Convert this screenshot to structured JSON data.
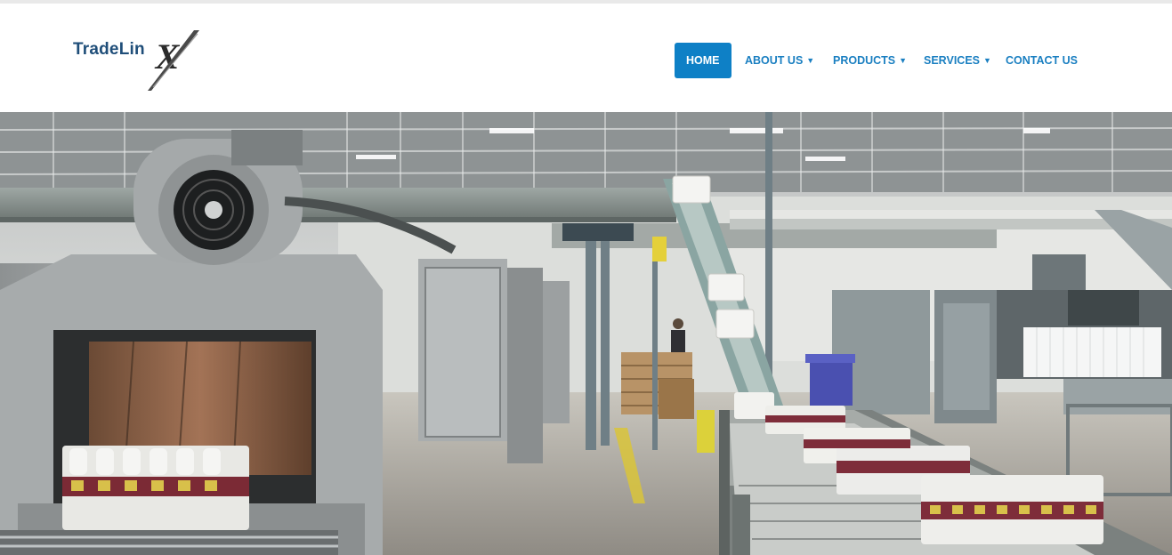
{
  "brand": {
    "name": "TradeLin",
    "mark": "X"
  },
  "nav": {
    "items": [
      {
        "label": "HOME",
        "caret": false,
        "active": true
      },
      {
        "label": "ABOUT US",
        "caret": true,
        "active": false
      },
      {
        "label": "PRODUCTS",
        "caret": true,
        "active": false
      },
      {
        "label": "SERVICES",
        "caret": true,
        "active": false
      },
      {
        "label": "CONTACT US",
        "caret": false,
        "active": false
      }
    ],
    "caret_glyph": "▼"
  },
  "hero": {
    "image_icon": "factory-bottling-line-photo"
  },
  "colors": {
    "brand_blue": "#1f4e79",
    "nav_link": "#1a7fc1",
    "nav_active_bg": "#0e80c6"
  }
}
